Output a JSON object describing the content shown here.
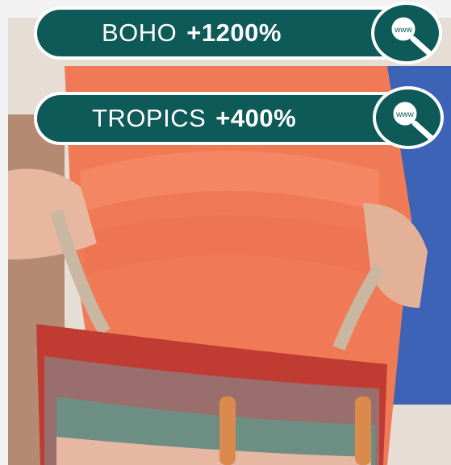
{
  "trends": [
    {
      "label": "BOHO",
      "value": "+1200%",
      "icon": "web-search-icon"
    },
    {
      "label": "TROPICS",
      "value": "+400%",
      "icon": "web-search-icon"
    }
  ],
  "search_icon_text": "www",
  "colors": {
    "pill_bg": "#0e5a58",
    "pill_border": "#ffffff"
  }
}
